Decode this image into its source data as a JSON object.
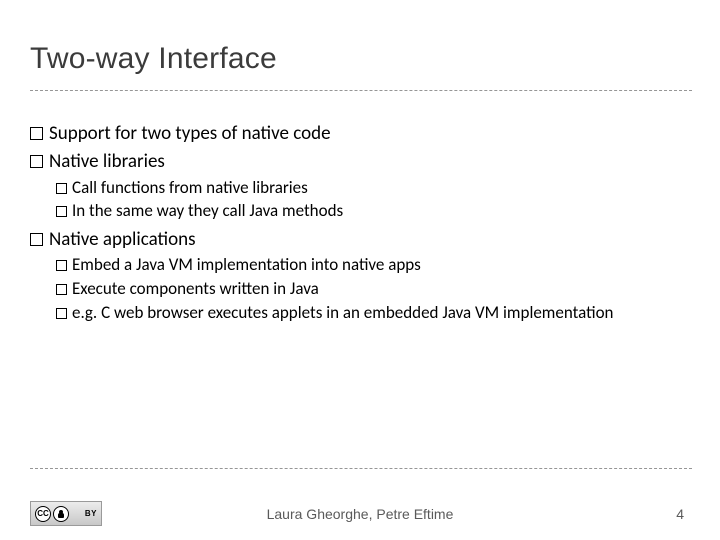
{
  "title": "Two-way Interface",
  "bullets": {
    "l1_1": "Support for two types of native code",
    "l1_2": "Native libraries",
    "l2_1": "Call functions from native libraries",
    "l2_2": "In the same way they call Java methods",
    "l1_3": "Native applications",
    "l2_3": "Embed a Java VM implementation into native apps",
    "l2_4": "Execute components written in Java",
    "l2_5": "e.g. C web browser executes applets in an embedded Java VM implementation"
  },
  "footer": {
    "authors": "Laura Gheorghe, Petre Eftime",
    "page": "4",
    "cc_text": "CC",
    "by_text": "BY"
  }
}
